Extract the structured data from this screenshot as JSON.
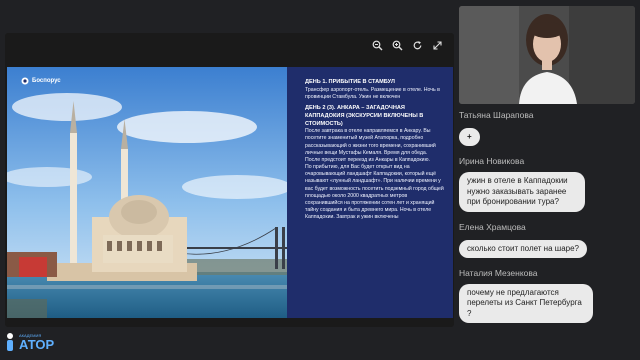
{
  "toolbar": {
    "icons": [
      "zoom-out-icon",
      "zoom-in-icon",
      "rotate-icon",
      "fullscreen-icon"
    ],
    "zoom_out": "⊖",
    "zoom_in": "⊕",
    "rotate": "↻",
    "fullscreen": "⤢"
  },
  "slide": {
    "brand": "Боспорус",
    "day1_title": "ДЕНЬ 1. ПРИБЫТИЕ В СТАМБУЛ",
    "day1_text": "Трансфер аэропорт-отель. Размещение в отеле. Ночь в провинции Стамбула. Ужин не включен",
    "day2_title": "ДЕНЬ 2 (3). АНКАРА – ЗАГАДОЧНАЯ КАППАДОКИЯ (ЭКСКУРСИИ ВКЛЮЧЕНЫ В СТОИМОСТЬ)",
    "day2_text1": "После завтрака в отеле направляемся в Анкару. Вы посетите знаменитый музей Ататюрка, подробно рассказывающий о жизни того времени, сохранивший личные вещи Мустафы Кемаля. Время для обеда.",
    "day2_text2": "После предстоит переезд из Анкары в Каппадокию.",
    "day2_text3": "По прибытию, для Вас будет открыт вид на очаровывающий ландшафт Каппадокии, который ещё называют «лунный ландшафт». При наличии времени у вас будет возможность посетить подземный город общей площадью около 2000 квадратных метров сохранившийся на протяжении сотен лет и хранящий тайну создания и быта древнего мира. Ночь в отеле Каппадокии. Завтрак и ужин включены"
  },
  "chat": [
    {
      "name": "Татьяна Шарапова",
      "message": "+"
    },
    {
      "name": "Ирина Новикова",
      "message": "ужин в отеле в Каппадокии нужно заказывать заранее при бронировании тура?"
    },
    {
      "name": "Елена Храмцова",
      "message": "сколько стоит полет на шаре?"
    },
    {
      "name": "Наталия Мезенкова",
      "message": "почему не предлагаются перелеты из Санкт Петербурга ?"
    }
  ],
  "logo": {
    "sub": "АКАДЕМИЯ",
    "main": "АТОР"
  },
  "colors": {
    "slide_bg": "#1f2d6b",
    "bubble": "#eaeaea",
    "logo": "#5fb0ff"
  }
}
